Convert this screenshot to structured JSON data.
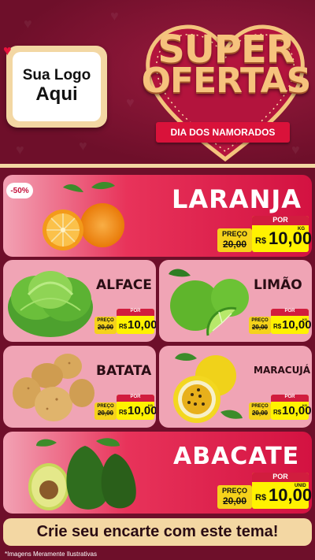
{
  "header": {
    "logo_line1": "Sua Logo",
    "logo_line2": "Aqui",
    "title_line1": "SUPER",
    "title_line2": "OFERTAS",
    "ribbon": "DIA DOS NAMORADOS"
  },
  "products": [
    {
      "name": "LARANJA",
      "badge": "-50%",
      "old_label": "PREÇO",
      "old_price": "20,00",
      "new_label": "POR",
      "currency": "R$",
      "new_price": "10,00",
      "unit": "KG"
    },
    {
      "name": "ALFACE",
      "old_label": "PREÇO",
      "old_price": "20,00",
      "new_label": "POR",
      "currency": "R$",
      "new_price": "10,00",
      "unit": ""
    },
    {
      "name": "LIMÃO",
      "old_label": "PREÇO",
      "old_price": "20,00",
      "new_label": "POR",
      "currency": "R$",
      "new_price": "10,00",
      "unit": "KG"
    },
    {
      "name": "BATATA",
      "old_label": "PREÇO",
      "old_price": "20,00",
      "new_label": "POR",
      "currency": "R$",
      "new_price": "10,00",
      "unit": "KG"
    },
    {
      "name": "MARACUJÁ",
      "old_label": "PREÇO",
      "old_price": "20,00",
      "new_label": "POR",
      "currency": "R$",
      "new_price": "10,00",
      "unit": "KG"
    },
    {
      "name": "ABACATE",
      "old_label": "PREÇO",
      "old_price": "20,00",
      "new_label": "POR",
      "currency": "R$",
      "new_price": "10,00",
      "unit": "UNID"
    }
  ],
  "footer": {
    "cta": "Crie seu encarte com este tema!"
  },
  "disclaimer": "*Imagens Meramente Ilustrativas",
  "colors": {
    "background": "#6e0f2a",
    "accent_red": "#d31241",
    "card_pink": "#f0a4b5",
    "gold": "#f3d7a3",
    "price_yellow": "#fff200"
  }
}
